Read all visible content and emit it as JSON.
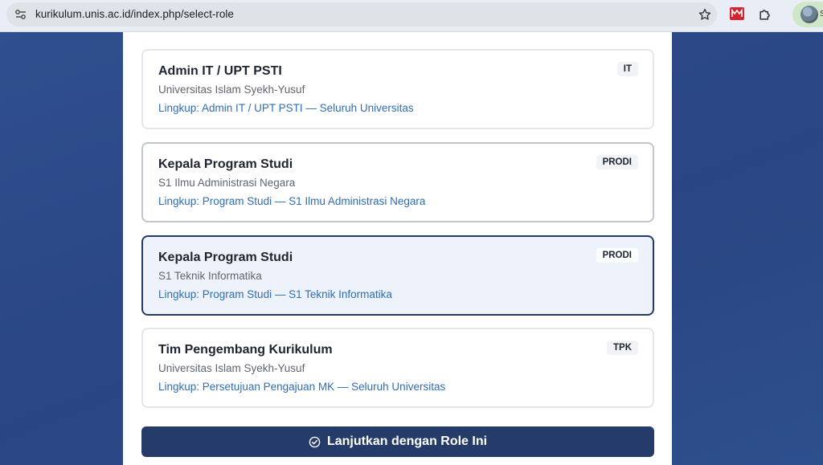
{
  "browser": {
    "url": "kurikulum.unis.ac.id/index.php/select-role",
    "profile_initial": "S"
  },
  "roles": [
    {
      "title": "Admin IT / UPT PSTI",
      "subtitle": "Universitas Islam Syekh-Yusuf",
      "scope": "Lingkup: Admin IT / UPT PSTI — Seluruh Universitas",
      "badge": "IT"
    },
    {
      "title": "Kepala Program Studi",
      "subtitle": "S1 Ilmu Administrasi Negara",
      "scope": "Lingkup: Program Studi — S1 Ilmu Administrasi Negara",
      "badge": "PRODI"
    },
    {
      "title": "Kepala Program Studi",
      "subtitle": "S1 Teknik Informatika",
      "scope": "Lingkup: Program Studi — S1 Teknik Informatika",
      "badge": "PRODI"
    },
    {
      "title": "Tim Pengembang Kurikulum",
      "subtitle": "Universitas Islam Syekh-Yusuf",
      "scope": "Lingkup: Persetujuan Pengajuan MK — Seluruh Universitas",
      "badge": "TPK"
    }
  ],
  "continue_label": "Lanjutkan dengan Role Ini",
  "colors": {
    "primary": "#253c6b",
    "link": "#2f6db5",
    "selected_bg": "#eef3fb"
  }
}
